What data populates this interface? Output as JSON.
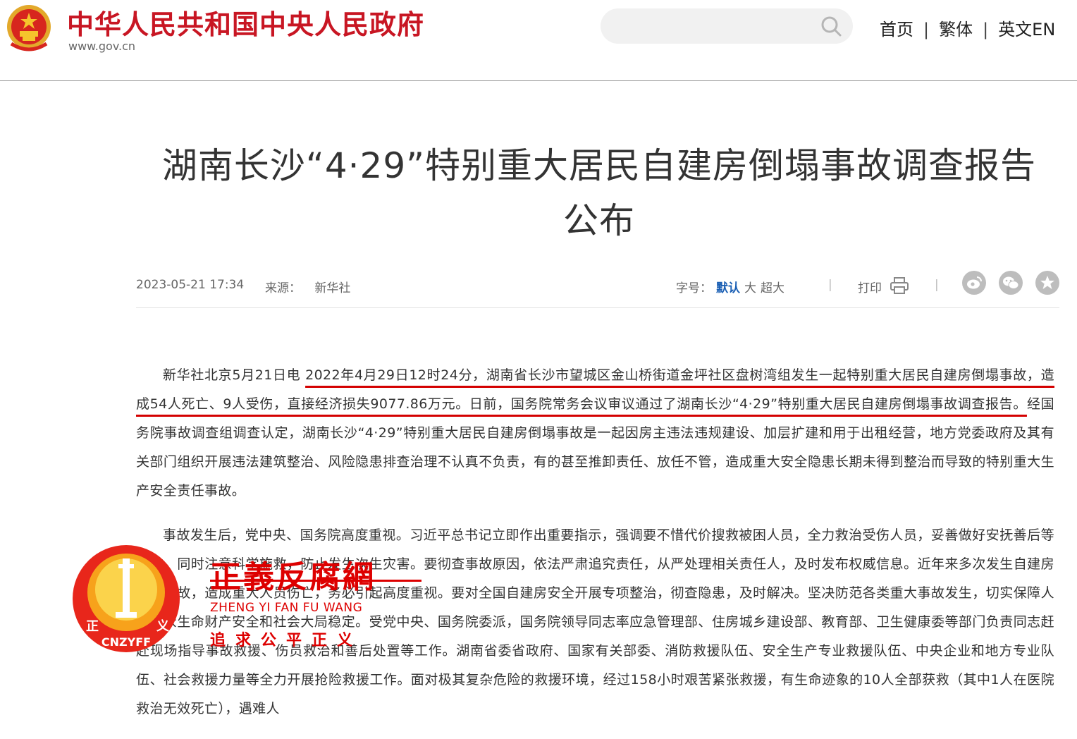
{
  "header": {
    "site_title": "中华人民共和国中央人民政府",
    "site_url": "www.gov.cn",
    "search_placeholder": "",
    "nav": {
      "home": "首页",
      "traditional": "繁体",
      "english": "英文EN",
      "separator": "|"
    }
  },
  "article": {
    "title_line1": "湖南长沙“4·29”特别重大居民自建房倒塌事故调查报告",
    "title_line2": "公布",
    "date": "2023-05-21 17:34",
    "source_label": "来源：",
    "source_value": "新华社",
    "fontsize_label": "字号：",
    "fontsize_options": [
      "默认",
      "大",
      "超大"
    ],
    "print_label": "打印",
    "share_icons": [
      "weibo-icon",
      "wechat-icon",
      "favorite-icon"
    ],
    "p1_lead": "新华社北京5月21日电 ",
    "p1_highlight": "2022年4月29日12时24分，湖南省长沙市望城区金山桥街道金坪社区盘树湾组发生一起特别重大居民自建房倒塌事故，造成54人死亡、9人受伤，直接经济损失9077.86万元。日前，国务院常务会议审议通过了湖南长沙“4·29”特别重大居民自建房倒塌事故调查报告。",
    "p1_rest": "经国务院事故调查组调查认定，湖南长沙“4·29”特别重大居民自建房倒塌事故是一起因房主违法违规建设、加层扩建和用于出租经营，地方党委政府及其有关部门组织开展违法建筑整治、风险隐患排查治理不认真不负责，有的甚至推卸责任、放任不管，造成重大安全隐患长期未得到整治而导致的特别重大生产安全责任事故。",
    "p2": "事故发生后，党中央、国务院高度重视。习近平总书记立即作出重要指示，强调要不惜代价搜救被困人员，全力救治受伤人员，妥善做好安抚善后等工作。同时注意科学施救，防止发生次生灾害。要彻查事故原因，依法严肃追究责任，从严处理相关责任人，及时发布权威信息。近年来多次发生自建房倒塌事故，造成重大人员伤亡，务必引起高度重视。要对全国自建房安全开展专项整治，彻查隐患，及时解决。坚决防范各类重大事故发生，切实保障人民群众生命财产安全和社会大局稳定。受党中央、国务院委派，国务院领导同志率应急管理部、住房城乡建设部、教育部、卫生健康委等部门负责同志赶赴现场指导事故救援、伤员救治和善后处置等工作。湖南省委省政府、国家有关部委、消防救援队伍、安全生产专业救援队伍、中央企业和地方专业队伍、社会救援力量等全力开展抢险救援工作。面对极其复杂危险的救援环境，经过158小时艰苦紧张救援，有生命迹象的10人全部获救（其中1人在医院救治无效死亡），遇难人"
  },
  "watermark": {
    "name": "正義反腐網",
    "pinyin": "ZHENG YI FAN FU WANG",
    "slogan": "追求公平正义",
    "badge_text": "CNZYFF",
    "badge_left": "正",
    "badge_right": "义"
  },
  "colors": {
    "brand_red": "#c81623",
    "accent_blue": "#1a5fb4",
    "underline_red": "#d40000"
  }
}
